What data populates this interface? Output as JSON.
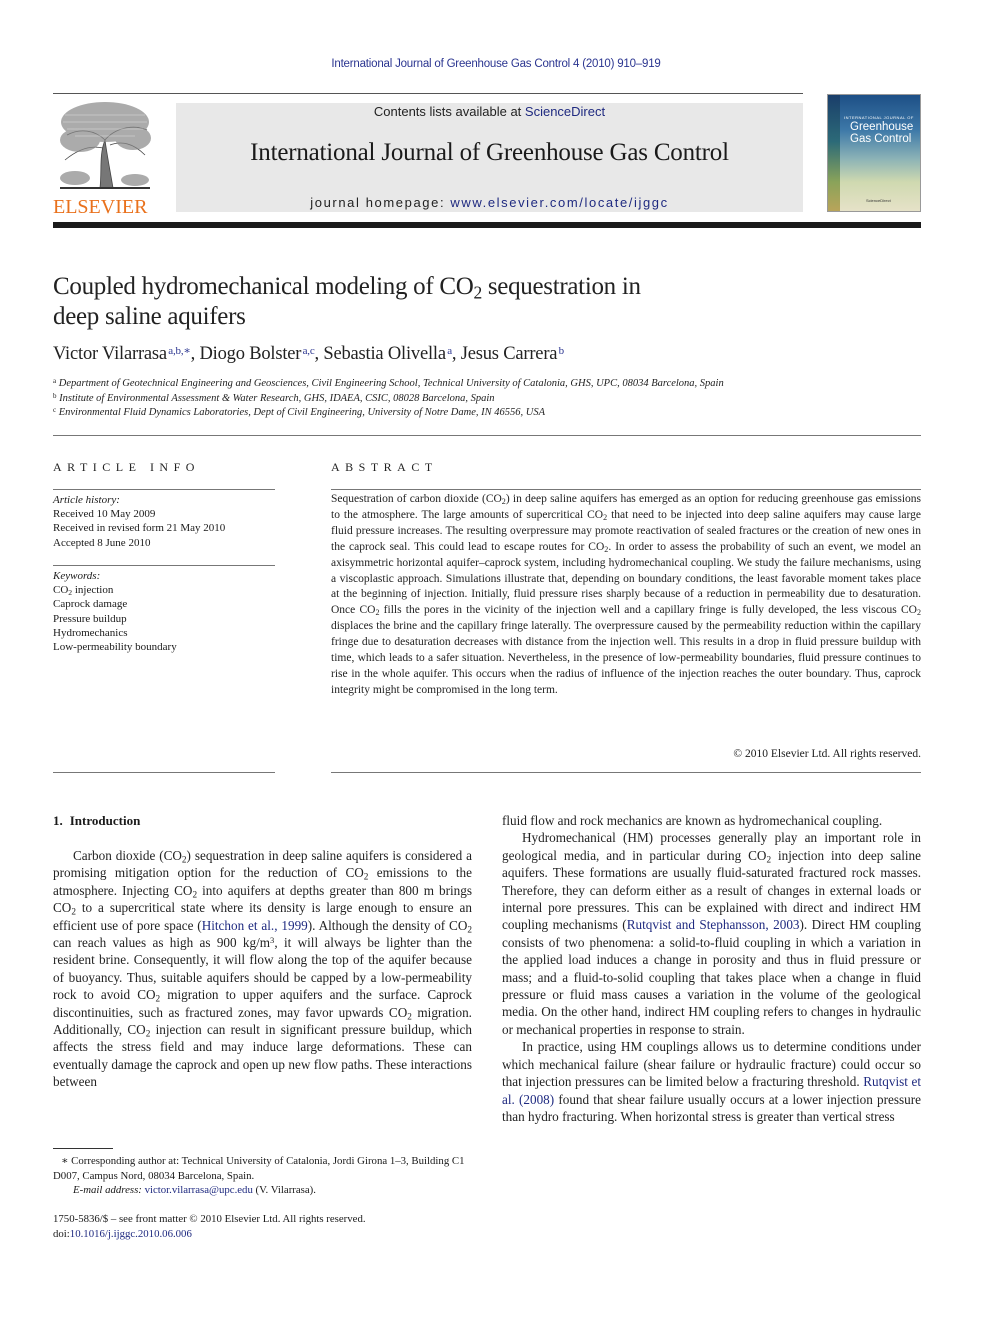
{
  "header": {
    "citation": "International Journal of Greenhouse Gas Control 4 (2010) 910–919",
    "contents_prefix": "Contents lists available at ",
    "contents_link": "ScienceDirect",
    "journal_title": "International Journal of Greenhouse Gas Control",
    "homepage_prefix": "journal homepage: ",
    "homepage_link": "www.elsevier.com/locate/ijggc",
    "publisher_logo_text": "ELSEVIER",
    "cover": {
      "small_caption": "INTERNATIONAL JOURNAL OF",
      "title_line1": "Greenhouse",
      "title_line2": "Gas Control",
      "footer": "ScienceDirect"
    }
  },
  "article": {
    "title_part1": "Coupled hydromechanical modeling of CO",
    "title_sub": "2",
    "title_part2": " sequestration in",
    "title_line2": "deep saline aquifers",
    "authors": [
      {
        "name": "Victor Vilarrasa",
        "sup": "a,b,∗",
        "sep": ", "
      },
      {
        "name": "Diogo Bolster",
        "sup": "a,c",
        "sep": ", "
      },
      {
        "name": "Sebastia Olivella",
        "sup": "a",
        "sep": ", "
      },
      {
        "name": "Jesus Carrera",
        "sup": "b",
        "sep": ""
      }
    ],
    "affiliations": [
      {
        "mark": "a",
        "text": "Department of Geotechnical Engineering and Geosciences, Civil Engineering School, Technical University of Catalonia, GHS, UPC, 08034 Barcelona, Spain"
      },
      {
        "mark": "b",
        "text": "Institute of Environmental Assessment & Water Research, GHS, IDAEA, CSIC, 08028 Barcelona, Spain"
      },
      {
        "mark": "c",
        "text": "Environmental Fluid Dynamics Laboratories, Dept of Civil Engineering, University of Notre Dame, IN 46556, USA"
      }
    ]
  },
  "article_info": {
    "heading": "ARTICLE INFO",
    "history_label": "Article history:",
    "history": [
      "Received 10 May 2009",
      "Received in revised form 21 May 2010",
      "Accepted 8 June 2010"
    ],
    "keywords_label": "Keywords:",
    "keyword_co2_prefix": "CO",
    "keyword_co2_sub": "2",
    "keyword_co2_suffix": " injection",
    "keywords": [
      "Caprock damage",
      "Pressure buildup",
      "Hydromechanics",
      "Low-permeability boundary"
    ]
  },
  "abstract": {
    "heading": "ABSTRACT",
    "segments": [
      "Sequestration of carbon dioxide (CO",
      "2",
      ") in deep saline aquifers has emerged as an option for reducing greenhouse gas emissions to the atmosphere. The large amounts of supercritical CO",
      "2",
      " that need to be injected into deep saline aquifers may cause large fluid pressure increases. The resulting overpressure may promote reactivation of sealed fractures or the creation of new ones in the caprock seal. This could lead to escape routes for CO",
      "2",
      ". In order to assess the probability of such an event, we model an axisymmetric horizontal aquifer–caprock system, including hydromechanical coupling. We study the failure mechanisms, using a viscoplastic approach. Simulations illustrate that, depending on boundary conditions, the least favorable moment takes place at the beginning of injection. Initially, fluid pressure rises sharply because of a reduction in permeability due to desaturation. Once CO",
      "2",
      " fills the pores in the vicinity of the injection well and a capillary fringe is fully developed, the less viscous CO",
      "2",
      " displaces the brine and the capillary fringe laterally. The overpressure caused by the permeability reduction within the capillary fringe due to desaturation decreases with distance from the injection well. This results in a drop in fluid pressure buildup with time, which leads to a safer situation. Nevertheless, in the presence of low-permeability boundaries, fluid pressure continues to rise in the whole aquifer. This occurs when the radius of influence of the injection reaches the outer boundary. Thus, caprock integrity might be compromised in the long term."
    ],
    "copyright": "© 2010 Elsevier Ltd. All rights reserved."
  },
  "introduction": {
    "number": "1.",
    "heading": "Introduction",
    "left_p1": [
      "Carbon dioxide (CO",
      "2",
      ") sequestration in deep saline aquifers is considered a promising mitigation option for the reduction of CO",
      "2",
      " emissions to the atmosphere. Injecting CO",
      "2",
      " into aquifers at depths greater than 800 m brings CO",
      "2",
      " to a supercritical state where its density is large enough to ensure an efficient use of pore space ("
    ],
    "cite_hitchon": "Hitchon et al., 1999",
    "left_p1_b": [
      "). Although the density of CO",
      "2",
      " can reach values as high as 900 kg/m"
    ],
    "sup3": "3",
    "left_p1_c": [
      ", it will always be lighter than the resident brine. Consequently, it will flow along the top of the aquifer because of buoyancy. Thus, suitable aquifers should be capped by a low-permeability rock to avoid CO",
      "2",
      " migration to upper aquifers and the surface. Caprock discontinuities, such as fractured zones, may favor upwards CO",
      "2",
      " migration. Additionally, CO",
      "2",
      " injection can result in significant pressure buildup, which affects the stress field and may induce large deformations. These can eventually damage the caprock and open up new flow paths. These interactions between"
    ],
    "right_p0": "fluid flow and rock mechanics are known as hydromechanical coupling.",
    "right_p1_a": "Hydromechanical (HM) processes generally play an important role in geological media, and in particular during CO",
    "right_p1_sub": "2",
    "right_p1_b": " injection into deep saline aquifers. These formations are usually fluid-saturated fractured rock masses. Therefore, they can deform either as a result of changes in external loads or internal pore pressures. This can be explained with direct and indirect HM coupling mechanisms (",
    "cite_rutqvist2003": "Rutqvist and Stephansson, 2003",
    "right_p1_c": "). Direct HM coupling consists of two phenomena: a solid-to-fluid coupling in which a variation in the applied load induces a change in porosity and thus in fluid pressure or mass; and a fluid-to-solid coupling that takes place when a change in fluid pressure or fluid mass causes a variation in the volume of the geological media. On the other hand, indirect HM coupling refers to changes in hydraulic or mechanical properties in response to strain.",
    "right_p2_a": "In practice, using HM couplings allows us to determine conditions under which mechanical failure (shear failure or hydraulic fracture) could occur so that injection pressures can be limited below a fracturing threshold. ",
    "cite_rutqvist2008": "Rutqvist et al. (2008)",
    "right_p2_b": " found that shear failure usually occurs at a lower injection pressure than hydro fracturing. When horizontal stress is greater than vertical stress"
  },
  "footnote": {
    "star": "∗",
    "corresponding": " Corresponding author at: Technical University of Catalonia, Jordi Girona 1–3, Building C1 D007, Campus Nord, 08034 Barcelona, Spain.",
    "email_label": "E-mail address:",
    "email": "victor.vilarrasa@upc.edu",
    "email_suffix": " (V. Vilarrasa)."
  },
  "front_matter": {
    "issn_line": "1750-5836/$ – see front matter © 2010 Elsevier Ltd. All rights reserved.",
    "doi_prefix": "doi:",
    "doi": "10.1016/j.ijggc.2010.06.006"
  },
  "colors": {
    "link": "#1f2a80",
    "elsevier_orange": "#e9711c",
    "masthead_bg": "#e8e8e8"
  }
}
